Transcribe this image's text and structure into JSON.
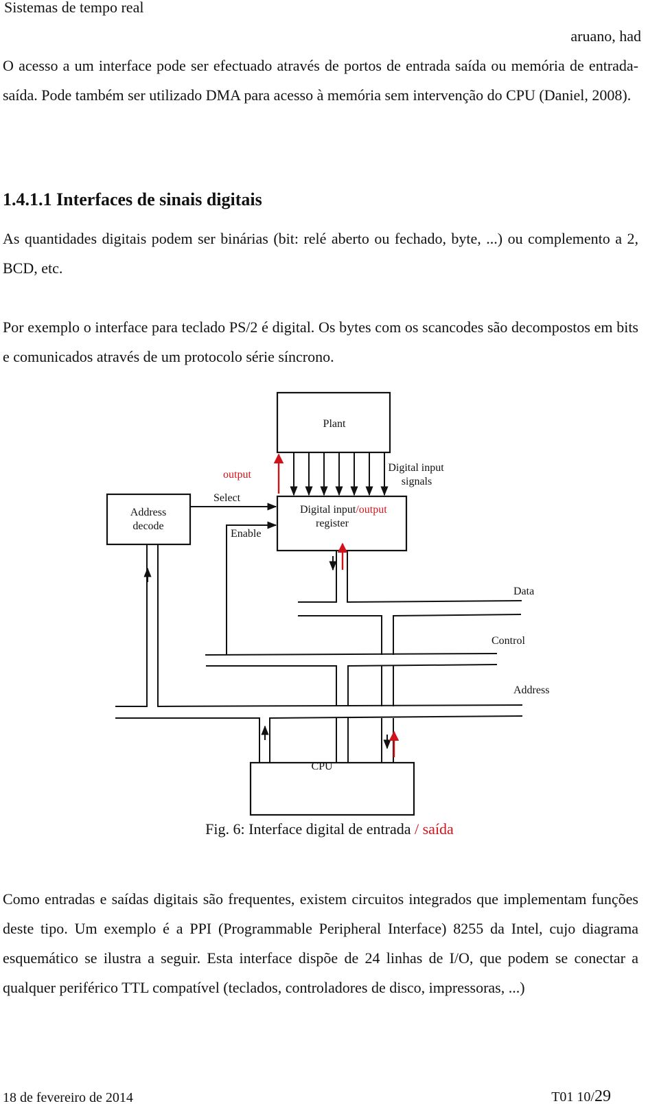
{
  "header": {
    "title": "Sistemas de tempo real",
    "author": "aruano, had"
  },
  "paragraphs": {
    "intro": "O acesso a um interface pode ser efectuado através de portos de entrada saída ou memória de entrada-saída. Pode também ser utilizado DMA para acesso à memória sem intervenção do CPU (Daniel, 2008).",
    "section_heading": "1.4.1.1 Interfaces de sinais digitais",
    "p1": "As quantidades digitais podem ser binárias (bit: relé aberto ou fechado, byte, ...) ou complemento a 2, BCD, etc.",
    "p2": "Por exemplo o interface para teclado PS/2 é digital. Os bytes com os scancodes são decompostos em bits e comunicados através de um protocolo série síncrono.",
    "p3": "Como entradas e saídas digitais são frequentes, existem circuitos integrados que implementam funções deste tipo. Um exemplo é a PPI (Programmable Peripheral Interface) 8255 da Intel, cujo diagrama esquemático se ilustra a seguir. Esta interface dispõe de 24 linhas de I/O, que podem se conectar a qualquer periférico TTL compatível (teclados, controladores de disco, impressoras, ...)"
  },
  "figure": {
    "blocks": {
      "plant": "Plant",
      "address_decode_line1": "Address",
      "address_decode_line2": "decode",
      "register_line1": "Digital input",
      "register_line1_added": "/output",
      "register_line2": "register",
      "cpu": "CPU"
    },
    "labels": {
      "output": "output",
      "select": "Select",
      "enable": "Enable",
      "digital_input_signals_line1": "Digital input",
      "digital_input_signals_line2": "signals",
      "data_bus": "Data",
      "control_bus": "Control",
      "address_bus": "Address"
    },
    "input_signal_count": 7,
    "annotation_color": "#d0121b",
    "caption_main": "Fig. 6: Interface digital de entrada",
    "caption_added": "/ saída"
  },
  "footer": {
    "date": "18 de fevereiro de 2014",
    "page_prefix": "T01 10/",
    "page_total": "29"
  }
}
